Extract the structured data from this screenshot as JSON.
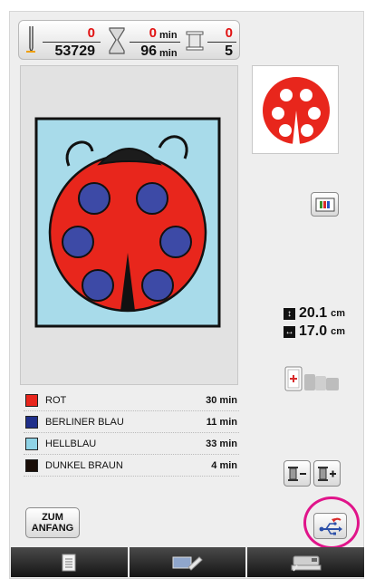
{
  "counter": {
    "stitch_current": "0",
    "stitch_total": "53729",
    "time_current": "0",
    "time_total": "96",
    "time_unit": "min",
    "color_current": "0",
    "color_total": "5"
  },
  "dimensions": {
    "height": "20.1",
    "width": "17.0",
    "unit": "cm"
  },
  "thread_colors": [
    {
      "name": "ROT",
      "time": "30 min",
      "color": "#e8261c"
    },
    {
      "name": "BERLINER BLAU",
      "time": "11 min",
      "color": "#1f2f8a"
    },
    {
      "name": "HELLBLAU",
      "time": "33 min",
      "color": "#8fd3e6"
    },
    {
      "name": "DUNKEL BRAUN",
      "time": "4 min",
      "color": "#1a0e08"
    }
  ],
  "buttons": {
    "start_label": "ZUM\nANFANG"
  },
  "icons": {
    "needle": "needle-icon",
    "hourglass": "hourglass-icon",
    "spool": "thread-spool-icon",
    "color_change": "color-change-icon",
    "frame": "hoop-frame-icon",
    "spool_minus": "spool-minus-icon",
    "spool_plus": "spool-plus-icon",
    "usb": "usb-icon",
    "document": "document-icon",
    "edit": "edit-icon",
    "machine": "sewing-machine-icon"
  }
}
